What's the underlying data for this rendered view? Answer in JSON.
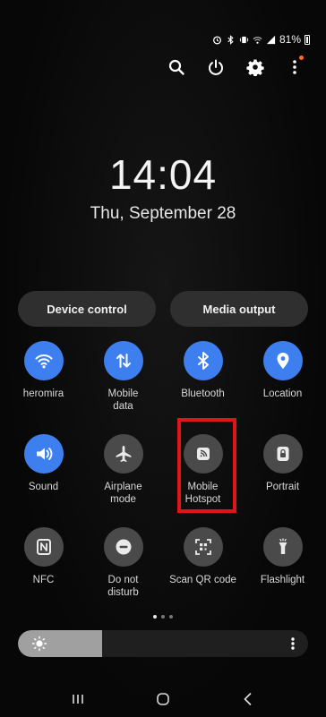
{
  "status_bar": {
    "battery_percent": "81%",
    "icons": [
      "clock-icon",
      "bluetooth-icon",
      "vibrate-icon",
      "wifi-icon",
      "signal-icon",
      "battery-icon"
    ]
  },
  "top_actions": [
    "search-icon",
    "power-icon",
    "settings-icon",
    "more-vertical-icon"
  ],
  "clock": {
    "time": "14:04",
    "date": "Thu, September 28"
  },
  "pills": {
    "device_control": "Device control",
    "media_output": "Media output"
  },
  "tiles": [
    {
      "label": "heromira",
      "icon": "wifi-icon",
      "active": true
    },
    {
      "label": "Mobile\ndata",
      "icon": "mobile-data-icon",
      "active": true
    },
    {
      "label": "Bluetooth",
      "icon": "bluetooth-icon",
      "active": true
    },
    {
      "label": "Location",
      "icon": "location-icon",
      "active": true
    },
    {
      "label": "Sound",
      "icon": "sound-icon",
      "active": true
    },
    {
      "label": "Airplane\nmode",
      "icon": "airplane-icon",
      "active": false
    },
    {
      "label": "Mobile\nHotspot",
      "icon": "hotspot-icon",
      "active": false
    },
    {
      "label": "Portrait",
      "icon": "portrait-lock-icon",
      "active": false
    },
    {
      "label": "NFC",
      "icon": "nfc-icon",
      "active": false
    },
    {
      "label": "Do not\ndisturb",
      "icon": "do-not-disturb-icon",
      "active": false
    },
    {
      "label": "Scan QR code",
      "icon": "qr-scan-icon",
      "active": false
    },
    {
      "label": "Flashlight",
      "icon": "flashlight-icon",
      "active": false
    }
  ],
  "pages": {
    "count": 3,
    "current": 1
  },
  "brightness": {
    "level": 0.29
  },
  "colors": {
    "active_tile": "#3e7ff0",
    "inactive_tile": "#4a4a4a",
    "highlight": "#e0141b",
    "notification_dot": "#ff6a2a"
  },
  "nav_bar": [
    "recents-icon",
    "home-icon",
    "back-icon"
  ]
}
